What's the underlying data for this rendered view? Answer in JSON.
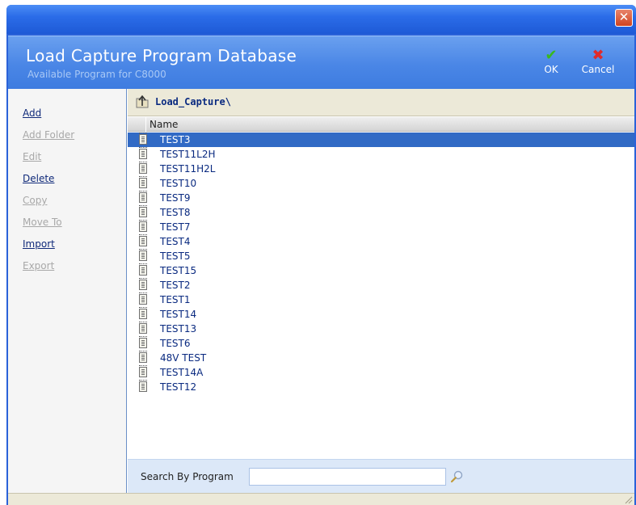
{
  "window": {
    "close_glyph": "✕"
  },
  "header": {
    "title": "Load Capture Program Database",
    "subtitle": "Available Program for C8000",
    "ok_label": "OK",
    "cancel_label": "Cancel"
  },
  "sidebar": {
    "items": [
      {
        "label": "Add",
        "enabled": true
      },
      {
        "label": "Add Folder",
        "enabled": false
      },
      {
        "label": "Edit",
        "enabled": false
      },
      {
        "label": "Delete",
        "enabled": true
      },
      {
        "label": "Copy",
        "enabled": false
      },
      {
        "label": "Move To",
        "enabled": false
      },
      {
        "label": "Import",
        "enabled": true
      },
      {
        "label": "Export",
        "enabled": false
      }
    ]
  },
  "path": {
    "current": "Load_Capture\\"
  },
  "list": {
    "column": "Name",
    "selected_index": 0,
    "items": [
      "TEST3",
      "TEST11L2H",
      "TEST11H2L",
      "TEST10",
      "TEST9",
      "TEST8",
      "TEST7",
      "TEST4",
      "TEST5",
      "TEST15",
      "TEST2",
      "TEST1",
      "TEST14",
      "TEST13",
      "TEST6",
      "48V TEST",
      "TEST14A",
      "TEST12"
    ]
  },
  "search": {
    "label": "Search By Program",
    "value": "",
    "placeholder": ""
  },
  "colors": {
    "selection": "#316ac5",
    "header": "#4a86e6",
    "titlebar": "#2b6ce8"
  },
  "icons": {
    "ok": "check-icon",
    "cancel": "x-icon",
    "up": "folder-up-icon",
    "search": "magnifier-icon",
    "file": "document-icon"
  }
}
